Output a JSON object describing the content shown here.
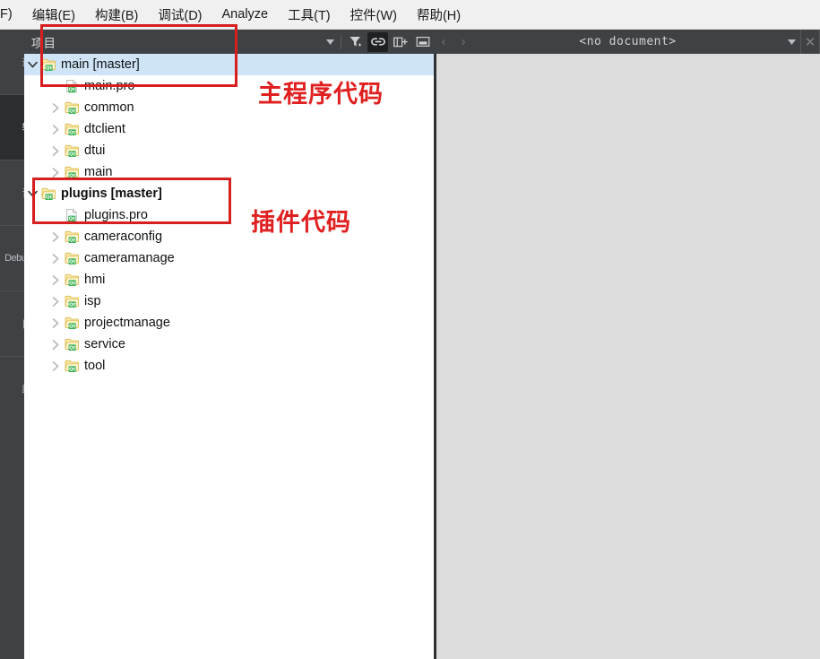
{
  "menubar": {
    "items": [
      {
        "label": "F)",
        "name": "menu-file"
      },
      {
        "label": "编辑(E)",
        "name": "menu-edit"
      },
      {
        "label": "构建(B)",
        "name": "menu-build"
      },
      {
        "label": "调试(D)",
        "name": "menu-debug"
      },
      {
        "label": "Analyze",
        "name": "menu-analyze"
      },
      {
        "label": "工具(T)",
        "name": "menu-tools"
      },
      {
        "label": "控件(W)",
        "name": "menu-window"
      },
      {
        "label": "帮助(H)",
        "name": "menu-help"
      }
    ]
  },
  "modebar": {
    "items": [
      {
        "label": "迎",
        "name": "mode-welcome",
        "active": false
      },
      {
        "label": "辑",
        "name": "mode-edit",
        "active": true
      },
      {
        "label": "计",
        "name": "mode-design",
        "active": false
      },
      {
        "label": "Debug",
        "name": "mode-debug",
        "active": false
      },
      {
        "label": "目",
        "name": "mode-projects",
        "active": false
      },
      {
        "label": "助",
        "name": "mode-help",
        "active": false
      }
    ]
  },
  "panel": {
    "title": "项目",
    "toolbar": {
      "combo_chevron": "▾",
      "filter_icon": "filter-icon",
      "link_icon": "link-icon",
      "split_icon": "split-view-icon",
      "collapse_icon": "collapse-panel-icon"
    }
  },
  "editor": {
    "document_title": "<no document>",
    "back_label": "‹",
    "forward_label": "›",
    "chevron": "▾",
    "close_label": "✕"
  },
  "tree": {
    "items": [
      {
        "label": "main [master]",
        "indent": 0,
        "twisty": "expanded",
        "icon": "qt-project-folder-icon",
        "bold": false,
        "selected": true,
        "name": "tree-item-main-master"
      },
      {
        "label": "main.pro",
        "indent": 1,
        "twisty": "none",
        "icon": "qt-pro-file-icon",
        "bold": false,
        "selected": false,
        "name": "tree-item-main-pro"
      },
      {
        "label": "common",
        "indent": 1,
        "twisty": "collapsed",
        "icon": "qt-project-folder-icon",
        "bold": false,
        "selected": false,
        "name": "tree-item-common"
      },
      {
        "label": "dtclient",
        "indent": 1,
        "twisty": "collapsed",
        "icon": "qt-project-folder-icon",
        "bold": false,
        "selected": false,
        "name": "tree-item-dtclient"
      },
      {
        "label": "dtui",
        "indent": 1,
        "twisty": "collapsed",
        "icon": "qt-project-folder-icon",
        "bold": false,
        "selected": false,
        "name": "tree-item-dtui"
      },
      {
        "label": "main",
        "indent": 1,
        "twisty": "collapsed",
        "icon": "qt-project-folder-icon",
        "bold": false,
        "selected": false,
        "name": "tree-item-main-sub"
      },
      {
        "label": "plugins [master]",
        "indent": 0,
        "twisty": "expanded",
        "icon": "qt-project-folder-icon",
        "bold": true,
        "selected": false,
        "name": "tree-item-plugins-master"
      },
      {
        "label": "plugins.pro",
        "indent": 1,
        "twisty": "none",
        "icon": "qt-pro-file-icon",
        "bold": false,
        "selected": false,
        "name": "tree-item-plugins-pro"
      },
      {
        "label": "cameraconfig",
        "indent": 1,
        "twisty": "collapsed",
        "icon": "qt-project-folder-icon",
        "bold": false,
        "selected": false,
        "name": "tree-item-cameraconfig"
      },
      {
        "label": "cameramanage",
        "indent": 1,
        "twisty": "collapsed",
        "icon": "qt-project-folder-icon",
        "bold": false,
        "selected": false,
        "name": "tree-item-cameramanage"
      },
      {
        "label": "hmi",
        "indent": 1,
        "twisty": "collapsed",
        "icon": "qt-project-folder-icon",
        "bold": false,
        "selected": false,
        "name": "tree-item-hmi"
      },
      {
        "label": "isp",
        "indent": 1,
        "twisty": "collapsed",
        "icon": "qt-project-folder-icon",
        "bold": false,
        "selected": false,
        "name": "tree-item-isp"
      },
      {
        "label": "projectmanage",
        "indent": 1,
        "twisty": "collapsed",
        "icon": "qt-project-folder-icon",
        "bold": false,
        "selected": false,
        "name": "tree-item-projectmanage"
      },
      {
        "label": "service",
        "indent": 1,
        "twisty": "collapsed",
        "icon": "qt-project-folder-icon",
        "bold": false,
        "selected": false,
        "name": "tree-item-service"
      },
      {
        "label": "tool",
        "indent": 1,
        "twisty": "collapsed",
        "icon": "qt-project-folder-icon",
        "bold": false,
        "selected": false,
        "name": "tree-item-tool"
      }
    ]
  },
  "annotations": {
    "color": "#d71f1f",
    "main_label": "主程序代码",
    "plugins_label": "插件代码"
  }
}
